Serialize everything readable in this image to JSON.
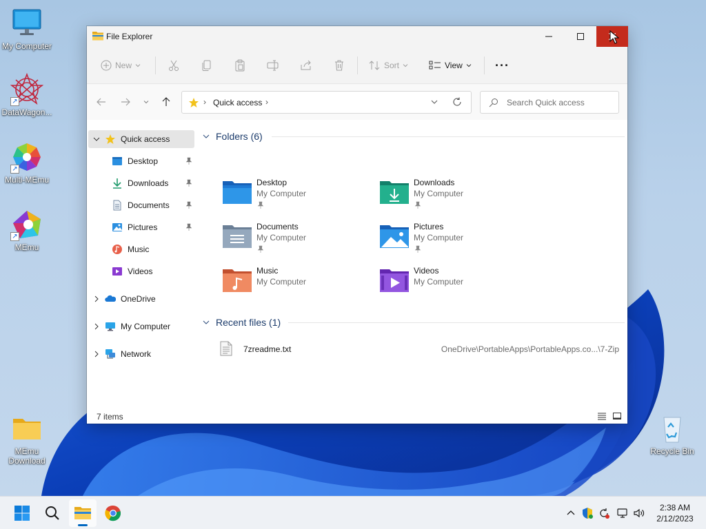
{
  "desktop": {
    "icons": [
      {
        "label": "My Computer"
      },
      {
        "label": "DataWagon..."
      },
      {
        "label": "Multi-MEmu"
      },
      {
        "label": "MEmu"
      },
      {
        "label": "MEmu Download"
      },
      {
        "label": "Recycle Bin"
      }
    ]
  },
  "window": {
    "title": "File Explorer"
  },
  "toolbar": {
    "new_label": "New",
    "sort_label": "Sort",
    "view_label": "View",
    "more_label": "···"
  },
  "address": {
    "location": "Quick access"
  },
  "search": {
    "placeholder": "Search Quick access"
  },
  "navpane": {
    "items": [
      {
        "label": "Quick access",
        "icon": "star-icon",
        "selected": true
      },
      {
        "label": "Desktop",
        "icon": "desktop-folder-icon",
        "pinned": true
      },
      {
        "label": "Downloads",
        "icon": "downloads-icon",
        "pinned": true
      },
      {
        "label": "Documents",
        "icon": "documents-icon",
        "pinned": true
      },
      {
        "label": "Pictures",
        "icon": "pictures-icon",
        "pinned": true
      },
      {
        "label": "Music",
        "icon": "music-icon"
      },
      {
        "label": "Videos",
        "icon": "videos-icon"
      },
      {
        "label": "OneDrive",
        "icon": "onedrive-icon"
      },
      {
        "label": "My Computer",
        "icon": "computer-icon"
      },
      {
        "label": "Network",
        "icon": "network-icon"
      }
    ]
  },
  "content": {
    "folders_header": "Folders (6)",
    "folders": [
      {
        "name": "Desktop",
        "location": "My Computer",
        "pinned": true
      },
      {
        "name": "Downloads",
        "location": "My Computer",
        "pinned": true
      },
      {
        "name": "Documents",
        "location": "My Computer",
        "pinned": true
      },
      {
        "name": "Pictures",
        "location": "My Computer",
        "pinned": true
      },
      {
        "name": "Music",
        "location": "My Computer",
        "pinned": false
      },
      {
        "name": "Videos",
        "location": "My Computer",
        "pinned": false
      }
    ],
    "recent_header": "Recent files (1)",
    "recent": [
      {
        "name": "7zreadme.txt",
        "path": "OneDrive\\PortableApps\\PortableApps.co...\\7-Zip"
      }
    ]
  },
  "status": {
    "item_count": "7 items"
  },
  "taskbar": {
    "clock_time": "2:38 AM",
    "clock_date": "2/12/2023"
  },
  "colors": {
    "accent": "#0067c0",
    "close_hover": "#c42b1c",
    "folder_yellow": "#f4c64e"
  }
}
